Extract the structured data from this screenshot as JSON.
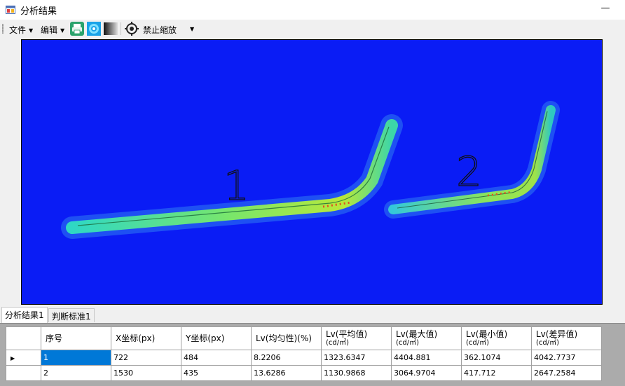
{
  "window": {
    "title": "分析结果",
    "minimize_glyph": "—"
  },
  "menu": {
    "file": "文件",
    "edit": "编辑",
    "zoom_mode": "禁止缩放",
    "icons": [
      "print-icon",
      "pseudocolor-icon",
      "grayscale-icon",
      "target-icon"
    ]
  },
  "image": {
    "labels": [
      "1",
      "2"
    ],
    "background_color": "#0a1cf5"
  },
  "tabs": [
    "分析结果1",
    "判断标准1"
  ],
  "table": {
    "headers": [
      {
        "main": "序号",
        "unit": ""
      },
      {
        "main": "X坐标(px)",
        "unit": ""
      },
      {
        "main": "Y坐标(px)",
        "unit": ""
      },
      {
        "main": "Lv(均匀性)(%)",
        "unit": ""
      },
      {
        "main": "Lv(平均值)",
        "unit": "(cd/㎡)"
      },
      {
        "main": "Lv(最大值)",
        "unit": "(cd/㎡)"
      },
      {
        "main": "Lv(最小值)",
        "unit": "(cd/㎡)"
      },
      {
        "main": "Lv(差异值)",
        "unit": "(cd/㎡)"
      }
    ],
    "rows": [
      [
        "1",
        "722",
        "484",
        "8.2206",
        "1323.6347",
        "4404.881",
        "362.1074",
        "4042.7737"
      ],
      [
        "2",
        "1530",
        "435",
        "13.6286",
        "1130.9868",
        "3064.9704",
        "417.712",
        "2647.2584"
      ]
    ],
    "selected_row": 0
  }
}
